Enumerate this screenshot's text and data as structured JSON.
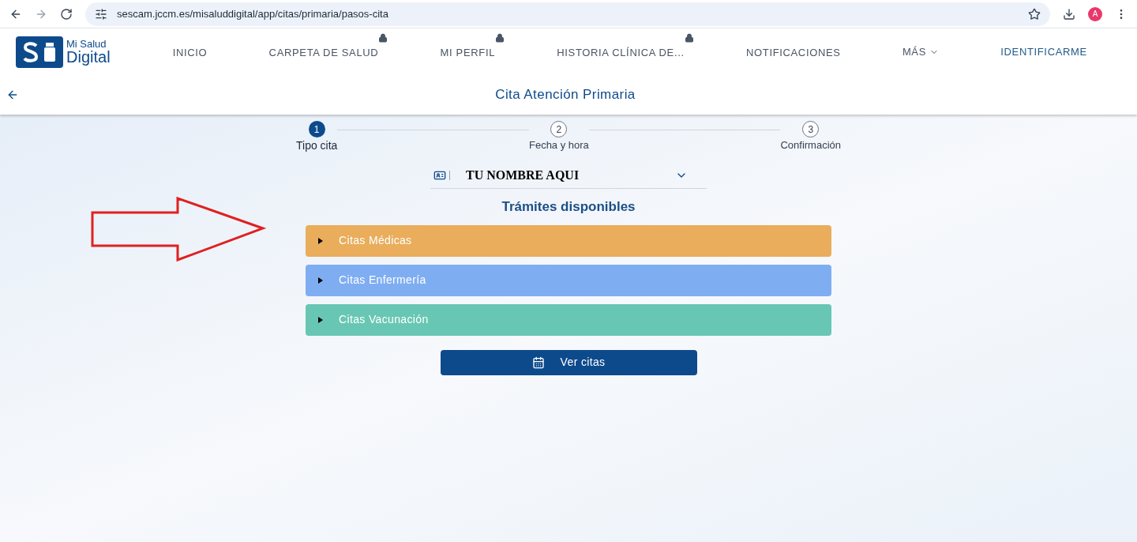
{
  "browser": {
    "url": "sescam.jccm.es/misaluddigital/app/citas/primaria/pasos-cita",
    "avatar_letter": "A"
  },
  "nav": {
    "logo": {
      "line1": "Mi Salud",
      "line2": "Digital"
    },
    "items": [
      {
        "label": "INICIO",
        "locked": false
      },
      {
        "label": "CARPETA DE SALUD",
        "locked": true
      },
      {
        "label": "MI PERFIL",
        "locked": true
      },
      {
        "label": "HISTORIA CLÍNICA DE...",
        "locked": true
      },
      {
        "label": "NOTIFICACIONES",
        "locked": false
      }
    ],
    "more": "MÁS",
    "login": "IDENTIFICARME"
  },
  "page_title": "Cita Atención Primaria",
  "steps": [
    {
      "number": "1",
      "label": "Tipo cita",
      "selected": true
    },
    {
      "number": "2",
      "label": "Fecha y hora",
      "selected": false
    },
    {
      "number": "3",
      "label": "Confirmación",
      "selected": false
    }
  ],
  "patient": {
    "name": "TU NOMBRE AQUI"
  },
  "section_title": "Trámites disponibles",
  "procedures": [
    {
      "label": "Citas Médicas",
      "color": "#e9ad5c"
    },
    {
      "label": "Citas Enfermería",
      "color": "#7fadf2"
    },
    {
      "label": "Citas Vacunación",
      "color": "#68c6b4"
    }
  ],
  "button": {
    "label": "Ver citas"
  }
}
